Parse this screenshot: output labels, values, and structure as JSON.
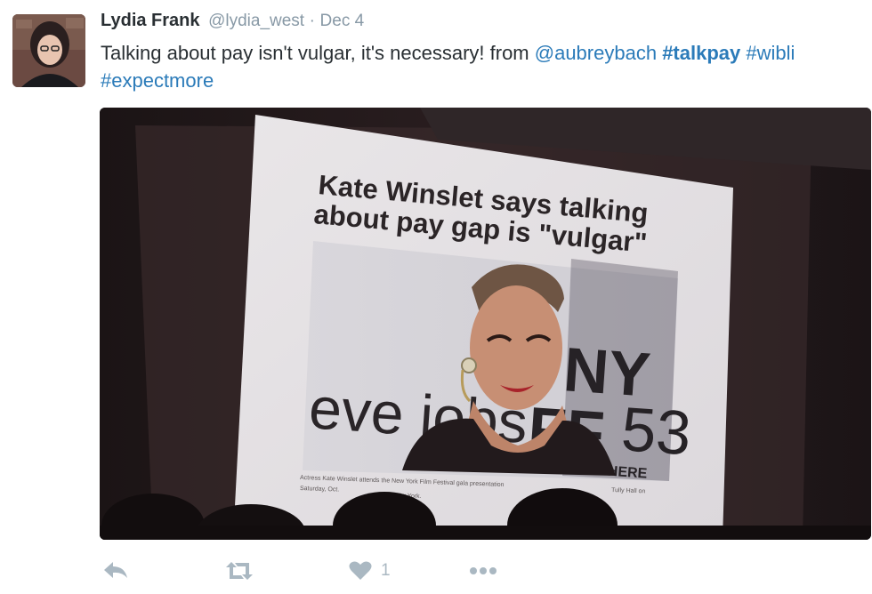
{
  "tweet": {
    "author_name": "Lydia Frank",
    "handle": "@lydia_west",
    "separator": "·",
    "date": "Dec 4",
    "text_plain": "Talking about pay isn't vulgar, it's necessary! from ",
    "mention": "@aubreybach",
    "hashtags": [
      "#talkpay",
      "#wibli",
      "#expectmore"
    ]
  },
  "media": {
    "slide_headline_line1": "Kate Winslet says talking",
    "slide_headline_line2": "about pay gap is \"vulgar\"",
    "backdrop_text_1": "eve jobs",
    "backdrop_text_2": "NY",
    "backdrop_text_3": "FF",
    "backdrop_text_4": "53",
    "backdrop_text_5": "LIVES HERE",
    "caption_line1": "Actress Kate Winslet attends the New York Film Festival gala presentation",
    "caption_line2": "Saturday, Oct.",
    "caption_line3": "New York.",
    "caption_line4": "Tully Hall on"
  },
  "actions": {
    "reply_icon": "reply-icon",
    "retweet_icon": "retweet-icon",
    "like_icon": "heart-icon",
    "like_count": "1",
    "more_icon": "more-icon",
    "icon_color": "#aab8c2"
  },
  "colors": {
    "link": "#2b7bb9",
    "text": "#292f33",
    "muted": "#8899a6"
  }
}
